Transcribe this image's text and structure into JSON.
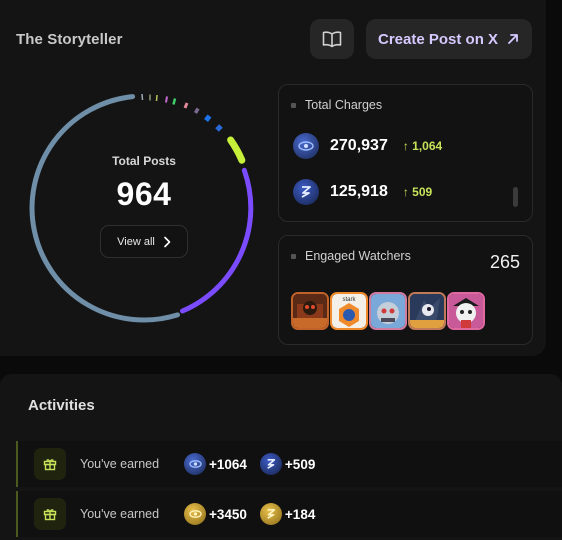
{
  "header": {
    "title": "The Storyteller",
    "book_icon": "book-open-icon",
    "create_label": "Create Post on X",
    "create_icon": "arrow-up-right-icon"
  },
  "posts": {
    "label": "Total Posts",
    "value": "964",
    "view_all": "View all"
  },
  "charges": {
    "title": "Total Charges",
    "rows": [
      {
        "icon": "eye-coin-icon",
        "value": "270,937",
        "delta": "↑ 1,064"
      },
      {
        "icon": "lightning-coin-icon",
        "value": "125,918",
        "delta": "↑ 509"
      }
    ]
  },
  "watchers": {
    "title": "Engaged Watchers",
    "count": "265",
    "avatar_label": "stark"
  },
  "activities": {
    "title": "Activities",
    "rows": [
      {
        "label": "You've earned",
        "r1": "+1064",
        "r2": "+509"
      },
      {
        "label": "You've earned",
        "r1": "+3450",
        "r2": "+184"
      }
    ]
  },
  "colors": {
    "accent_purple": "#7b4cff",
    "accent_lime": "#c7e35a",
    "ring_blue": "#6f8ea8"
  }
}
